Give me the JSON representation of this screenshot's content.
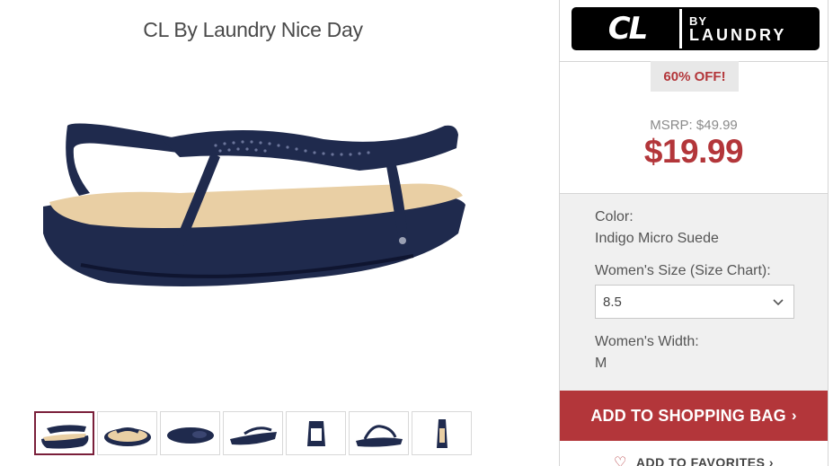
{
  "product": {
    "title": "CL By Laundry Nice Day"
  },
  "brand": {
    "cl": "CL",
    "by": "BY",
    "laundry": "LAUNDRY"
  },
  "pricing": {
    "discount": "60% OFF!",
    "msrp": "MSRP: $49.99",
    "price": "$19.99"
  },
  "options": {
    "color_label": "Color:",
    "color_value": "Indigo Micro Suede",
    "size_label": "Women's Size (Size Chart):",
    "size_selected": "8.5",
    "width_label": "Women's Width:",
    "width_value": "M"
  },
  "actions": {
    "add_to_bag": "ADD TO SHOPPING BAG",
    "add_to_bag_arrow": "›",
    "add_to_favorites": "ADD TO FAVORITES ›",
    "heart_icon": "heart-icon"
  },
  "thumbnails": [
    "view-1",
    "view-2",
    "view-3",
    "view-4",
    "view-5",
    "view-6",
    "view-7"
  ],
  "colors": {
    "accent": "#b3363a",
    "sandal": "#1f2a4d",
    "footbed": "#e9cfa4"
  }
}
